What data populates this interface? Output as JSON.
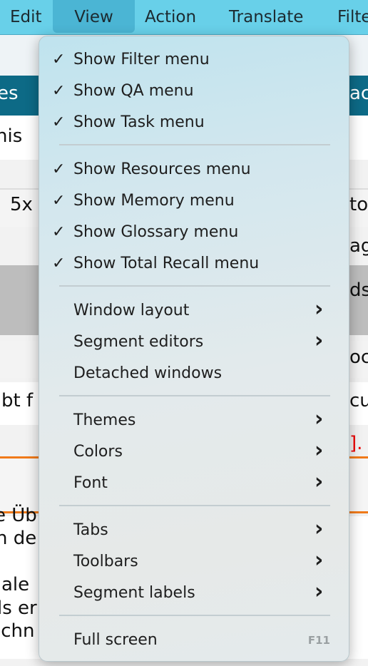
{
  "menubar": {
    "items": [
      "Edit",
      "View",
      "Action",
      "Translate",
      "Filte"
    ],
    "active": "View"
  },
  "background": {
    "left": [
      "es",
      "nis",
      "5x",
      "bt f",
      "e Üb",
      "n de",
      "ale",
      "ls er",
      "ichn"
    ],
    "right": [
      "ac",
      "to",
      "ag",
      "ds",
      "oc",
      "cu",
      "]."
    ]
  },
  "colors": {
    "menubar": "#68d0e9",
    "active": "#4bb5d4",
    "header_band": "#0d6a86",
    "accent_orange": "#f07a1a"
  },
  "view_menu": {
    "groups": [
      [
        {
          "label": "Show Filter menu",
          "checked": true
        },
        {
          "label": "Show QA menu",
          "checked": true
        },
        {
          "label": "Show Task menu",
          "checked": true
        }
      ],
      [
        {
          "label": "Show Resources menu",
          "checked": true
        },
        {
          "label": "Show Memory menu",
          "checked": true
        },
        {
          "label": "Show Glossary menu",
          "checked": true
        },
        {
          "label": "Show Total Recall menu",
          "checked": true
        }
      ],
      [
        {
          "label": "Window layout",
          "submenu": true
        },
        {
          "label": "Segment editors",
          "submenu": true
        },
        {
          "label": "Detached windows"
        }
      ],
      [
        {
          "label": "Themes",
          "submenu": true
        },
        {
          "label": "Colors",
          "submenu": true
        },
        {
          "label": "Font",
          "submenu": true
        }
      ],
      [
        {
          "label": "Tabs",
          "submenu": true
        },
        {
          "label": "Toolbars",
          "submenu": true
        },
        {
          "label": "Segment labels",
          "submenu": true
        }
      ],
      [
        {
          "label": "Full screen",
          "shortcut": "F11"
        }
      ]
    ],
    "check_glyph": "✓",
    "chevron_glyph": "›"
  }
}
